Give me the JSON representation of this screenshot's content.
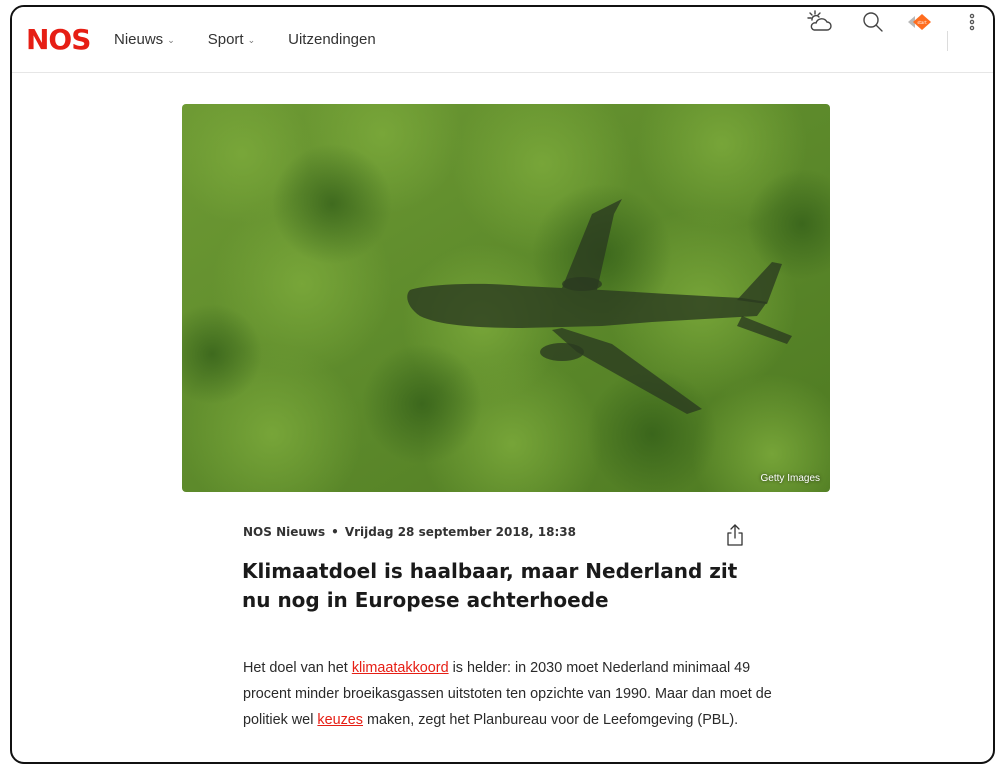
{
  "header": {
    "logo": "NOS",
    "nav": [
      {
        "label": "Nieuws",
        "has_dropdown": true
      },
      {
        "label": "Sport",
        "has_dropdown": true
      },
      {
        "label": "Uitzendingen",
        "has_dropdown": false
      }
    ],
    "tools": [
      "weather-icon",
      "search-icon",
      "npo-start-icon",
      "more-menu-icon"
    ],
    "brand_color": "#e61e14"
  },
  "hero": {
    "credit": "Getty Images"
  },
  "article": {
    "source": "NOS Nieuws",
    "separator": "•",
    "date": "Vrijdag 28 september 2018, 18:38",
    "title": "Klimaatdoel is haalbaar, maar Nederland zit nu nog in Europese achterhoede",
    "body": {
      "p1_a": "Het doel van het ",
      "link1": "klimaatakkoord",
      "p1_b": " is helder: in 2030 moet Nederland minimaal 49 procent minder broeikasgassen uitstoten ten opzichte van 1990. Maar dan moet de politiek wel ",
      "link2": "keuzes",
      "p1_c": " maken, zegt het Planbureau voor de Leefomgeving (PBL)."
    }
  }
}
